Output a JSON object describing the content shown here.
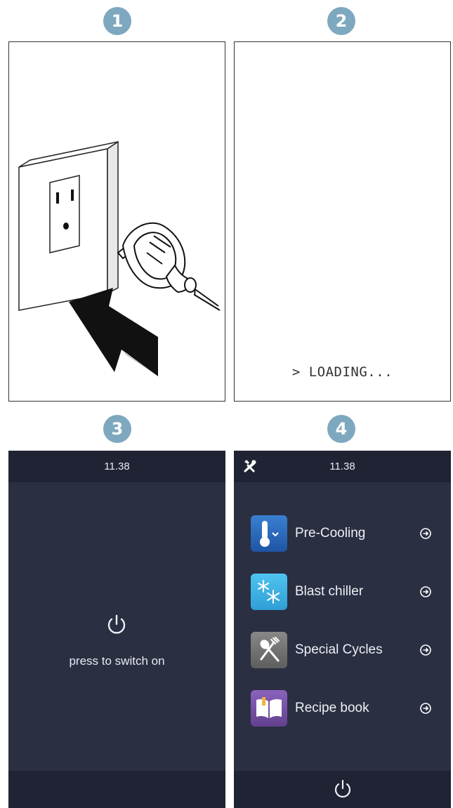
{
  "steps": [
    {
      "number": "1"
    },
    {
      "number": "2",
      "loading_text": "> LOADING..."
    },
    {
      "number": "3",
      "time": "11.38",
      "prompt": "press to switch on"
    },
    {
      "number": "4",
      "time": "11.38"
    }
  ],
  "menu": {
    "items": [
      {
        "label": "Pre-Cooling",
        "icon": "thermometer-icon"
      },
      {
        "label": "Blast chiller",
        "icon": "snowflake-icon"
      },
      {
        "label": "Special Cycles",
        "icon": "spoon-fork-icon"
      },
      {
        "label": "Recipe book",
        "icon": "book-icon"
      }
    ]
  },
  "colors": {
    "badge": "#7ea8bf",
    "screen_bg": "#2a2f42",
    "bar_bg": "#1f2334",
    "precooling_icon": "#2a66b8",
    "blast_icon": "#3fb5e6",
    "special_icon": "#6f6f6f",
    "recipe_icon": "#7a55a8"
  }
}
